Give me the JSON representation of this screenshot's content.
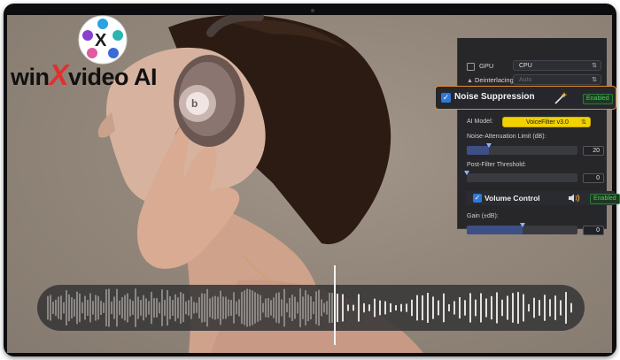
{
  "logo": {
    "text_before": "win",
    "text_x": "X",
    "text_after": "video AI"
  },
  "panel": {
    "gpu_label": "GPU",
    "gpu_value": "CPU",
    "deinterlacing_label": "Deinterlacing",
    "deinterlacing_value": "Auto",
    "noise_suppression": {
      "label": "Noise Suppression",
      "status": "Enabled",
      "checked": true
    },
    "ai_model_label": "AI Model:",
    "ai_model_value": "VoiceFilter v3.0",
    "noise_attenuation_label": "Noise-Attenuation Limit (dB):",
    "noise_attenuation_value": "20",
    "noise_attenuation_level": 0.2,
    "post_filter_label": "Post-Filter Threshold:",
    "post_filter_value": "0",
    "post_filter_level": 0.0,
    "volume_control": {
      "label": "Volume Control",
      "status": "Enabled",
      "checked": true
    },
    "gain_label": "Gain (±dB):",
    "gain_value": "0",
    "gain_level": 0.5
  },
  "waveform": {
    "playhead_position": 0.54
  },
  "colors": {
    "accent": "#e08b2a",
    "check_blue": "#2f78d8",
    "enabled_green": "#4ecb5c",
    "ai_model_yellow": "#f1d200"
  },
  "icons": [
    "gpu-checkbox-icon",
    "deinterlacing-icon",
    "magic-wand-icon",
    "speaker-icon",
    "chevron-down-icon"
  ]
}
